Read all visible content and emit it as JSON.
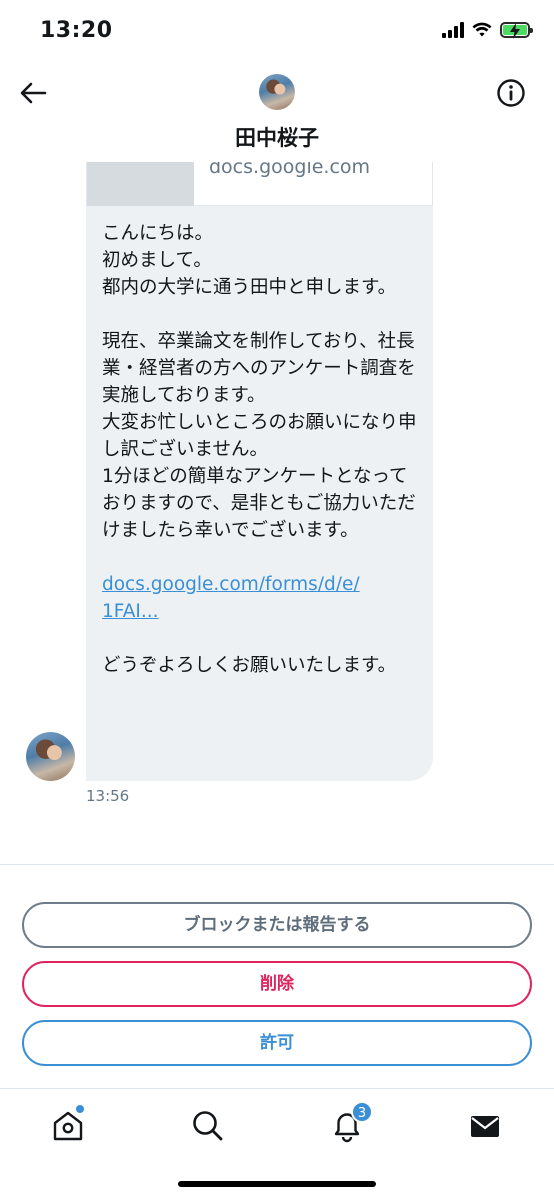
{
  "status_bar": {
    "time": "13:20",
    "battery_color": "#4cd964"
  },
  "header": {
    "contact_name": "田中桜子",
    "back_icon": "arrow-left-icon",
    "info_icon": "info-circle-icon"
  },
  "conversation": {
    "link_preview": {
      "domain": "docs.google.com"
    },
    "message": {
      "text_part1": "こんにちは。\n初めまして。\n都内の大学に通う田中と申します。\n\n現在、卒業論文を制作しており、社長業・経営者の方へのアンケート調査を実施しております。\n大変お忙しいところのお願いになり申し訳ございません。\n1分ほどの簡単なアンケートとなっておりますので、是非ともご協力いただけましたら幸いでございます。",
      "link": "docs.google.com/forms/d/e/\n1FAI...",
      "text_part2": "どうぞよろしくお願いいたします。",
      "timestamp": "13:56"
    }
  },
  "actions": {
    "block_report": "ブロックまたは報告する",
    "delete": "削除",
    "allow": "許可"
  },
  "tab_bar": {
    "items": [
      {
        "icon": "home-icon"
      },
      {
        "icon": "search-icon"
      },
      {
        "icon": "bell-icon"
      },
      {
        "icon": "mail-icon"
      }
    ],
    "notification_count": "3",
    "accent_color": "#3a8fd6",
    "danger_color": "#e0245e"
  }
}
